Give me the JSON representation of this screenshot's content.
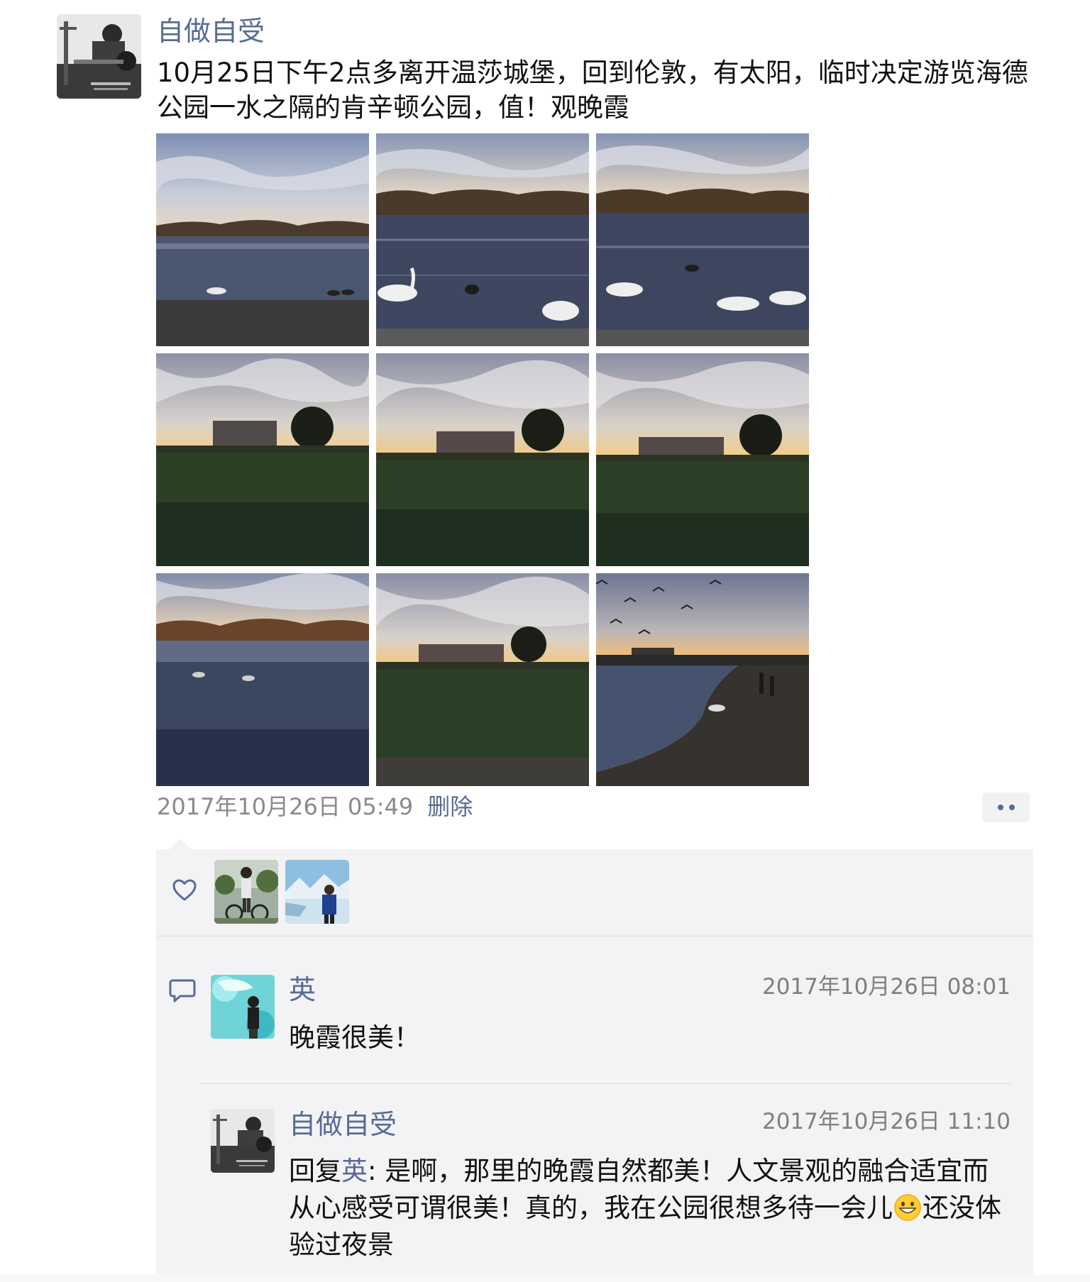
{
  "post": {
    "author": "自做自受",
    "text": "10月25日下午2点多离开温莎城堡，回到伦敦，有太阳，临时决定游览海德公园一水之隔的肯辛顿公园，值！观晚霞",
    "timestamp": "2017年10月26日 05:49",
    "delete_label": "删除"
  },
  "photos": [
    {
      "scene": "lake-swans-wide"
    },
    {
      "scene": "lake-swans-close"
    },
    {
      "scene": "lake-swans-three"
    },
    {
      "scene": "palace-lawn-sunset"
    },
    {
      "scene": "palace-lawn-sunset"
    },
    {
      "scene": "palace-lawn-sunset"
    },
    {
      "scene": "lake-evening"
    },
    {
      "scene": "palace-lawn-sunset"
    },
    {
      "scene": "pond-birds-dusk"
    }
  ],
  "likes": {
    "icon": "heart-icon",
    "users": [
      {
        "avatar": "cyclist-avatar"
      },
      {
        "avatar": "glacier-avatar"
      }
    ]
  },
  "comments": [
    {
      "name": "英",
      "time": "2017年10月26日 08:01",
      "text": "晚霞很美！"
    },
    {
      "name": "自做自受",
      "time": "2017年10月26日 11:10",
      "reply_prefix": "回复",
      "reply_to": "英",
      "text_part1": ": 是啊，那里的晚霞自然都美！人文景观的融合适宜而从心感受可谓很美！真的，我在公园很想多待一会儿",
      "emoji": "grin-emoji",
      "text_part2": "还没体验过夜景"
    }
  ],
  "colors": {
    "link": "#576b95",
    "panel": "#f3f3f5",
    "meta": "#8a8a8a"
  }
}
